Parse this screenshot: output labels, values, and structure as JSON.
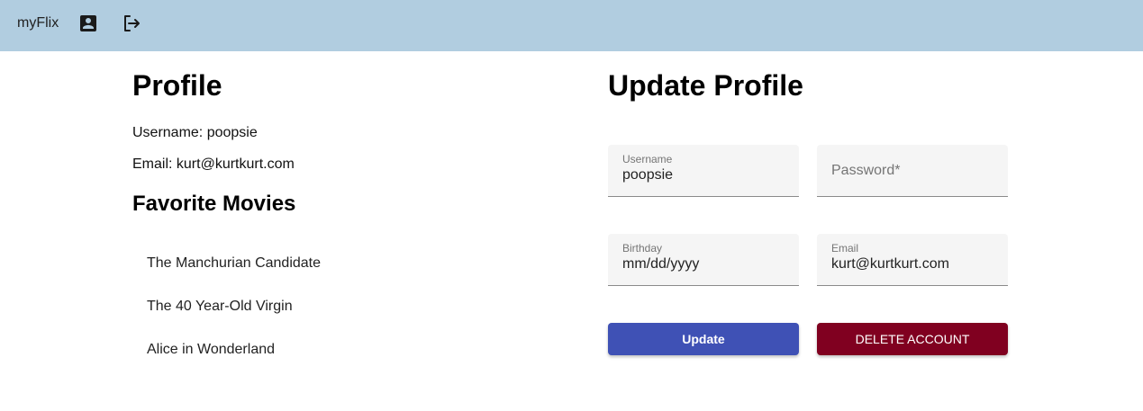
{
  "appbar": {
    "brand": "myFlix",
    "background": "#b1cde0",
    "icons": [
      "account-box-icon",
      "logout-icon"
    ]
  },
  "profile": {
    "title": "Profile",
    "username_line": "Username: poopsie",
    "email_line": "Email: kurt@kurtkurt.com",
    "favorites_title": "Favorite Movies",
    "favorites": [
      "The Manchurian Candidate",
      "The 40 Year-Old Virgin",
      "Alice in Wonderland"
    ]
  },
  "update": {
    "title": "Update Profile",
    "username": {
      "label": "Username",
      "value": "poopsie"
    },
    "password": {
      "placeholder": "Password*"
    },
    "birthday": {
      "label": "Birthday",
      "value": "mm/dd/yyyy"
    },
    "email": {
      "label": "Email",
      "value": "kurt@kurtkurt.com"
    },
    "update_button": "Update",
    "delete_button": "DELETE ACCOUNT"
  },
  "colors": {
    "update_button": "#3f51b5",
    "delete_button": "#800020"
  }
}
